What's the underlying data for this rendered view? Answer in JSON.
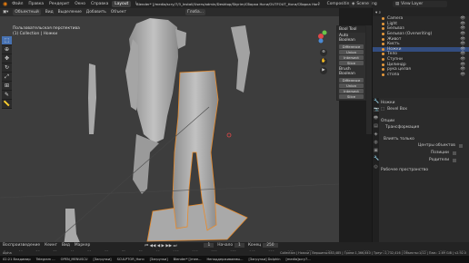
{
  "menu": [
    "Файл",
    "Правка",
    "Рендерит",
    "Окно",
    "Справка"
  ],
  "workspaces": [
    "Layout",
    "Modeling",
    "Sculpting",
    "UV Editing",
    "Texture Paint",
    "Shading",
    "Animation",
    "Rendering",
    "Compositing",
    "Scripting"
  ],
  "active_workspace": "Layout",
  "window_title": "Blender* [/media/scry/7/3_Install/Users/admin/Desktop/Skyrim/Сборка Ноги/OUTFOUT_Ноги/Сборка Ноги.blend]",
  "scene": "Scene",
  "view_layer": "View Layer",
  "header": {
    "mode": "Объектный",
    "view": "Вид",
    "select": "Выделение",
    "add": "Добавить",
    "object": "Объект",
    "orientation": "Глоба..."
  },
  "overlay": {
    "line1": "Пользовательская перспектива",
    "line2": "(1) Collection | Ножки"
  },
  "tool_panel": {
    "title": "Bool Tool",
    "auto": "Auto Boolean",
    "auto_buttons": [
      "Difference",
      "Union",
      "Intersect",
      "Slice"
    ],
    "brush": "Brush Boolean",
    "brush_buttons": [
      "Difference",
      "Union",
      "Intersect",
      "Slice"
    ]
  },
  "outliner": {
    "items": [
      {
        "label": "Camera",
        "sel": false
      },
      {
        "label": "Light",
        "sel": false
      },
      {
        "label": "Бельваз",
        "sel": false
      },
      {
        "label": "Бельваз (Overwriting)",
        "sel": false
      },
      {
        "label": "Живот",
        "sel": false
      },
      {
        "label": "Кисть",
        "sel": false
      },
      {
        "label": "Ножки",
        "sel": true
      },
      {
        "label": "Тело",
        "sel": false
      },
      {
        "label": "Ступни",
        "sel": false
      },
      {
        "label": "Цилиндр",
        "sel": false
      },
      {
        "label": "рука целая",
        "sel": false
      },
      {
        "label": "стопа",
        "sel": false
      }
    ]
  },
  "properties": {
    "object": "Ножки",
    "brick": "Bevel Box",
    "options": "Опции",
    "transform": "Трансформация",
    "affect_only": "Влиять только",
    "origins": "Центры объектов",
    "locations": "Позиции",
    "parents": "Родители",
    "workspace": "Рабочее пространство"
  },
  "timeline": {
    "playback": "Воспроизведение",
    "keying": "Кеинг",
    "view": "Вид",
    "marker": "Маркер",
    "frame": "1",
    "start_label": "Начало",
    "start": "1",
    "end_label": "Конец",
    "end": "250",
    "ticks": [
      "0",
      "10",
      "20",
      "30",
      "40",
      "50",
      "60",
      "70",
      "80",
      "90",
      "100",
      "110",
      "120",
      "130",
      "140",
      "150",
      "160",
      "170",
      "180",
      "190",
      "200",
      "210",
      "220",
      "230",
      "240",
      "250"
    ]
  },
  "status": {
    "text": "Collection | Ножки | Вершины:683,485 | Грани:1,366,640 | Треуг.:2,732,416 | Объекты:1/12 | Пам.: 2.69 GiB | v2.92.0",
    "left": "Alpha"
  },
  "taskbar": [
    "02:21 Владимир",
    "Telegram ...",
    "OPEN_MENUSCU",
    "[Загрузки]",
    "SCULPTOR_Ноги",
    "[Загрузки]",
    "Blender* [/mee...",
    "Неподдерживаемы...",
    "[Загрузки] Dolphin",
    "[media]scry7..."
  ]
}
